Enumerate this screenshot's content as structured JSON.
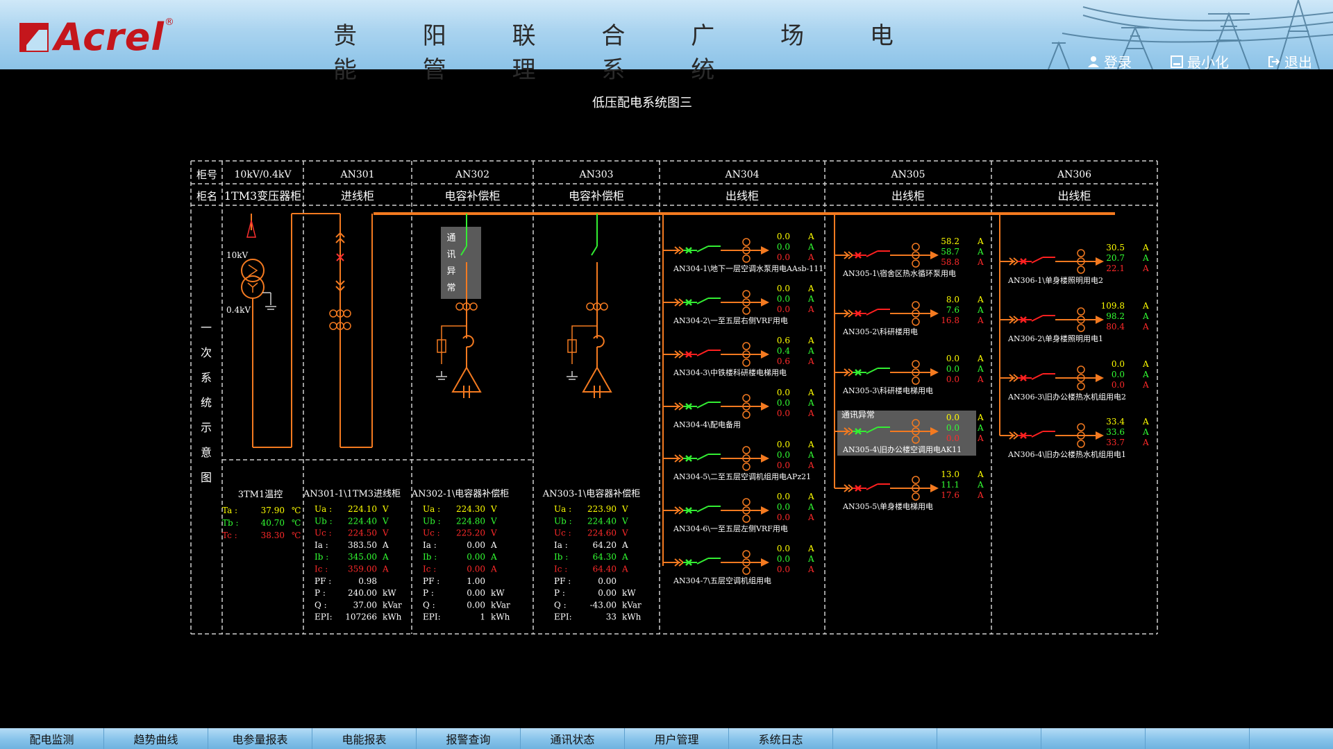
{
  "header": {
    "logo_text": "Acrel",
    "logo_reg": "®",
    "title": "贵 阳 联 合 广 场 电 能 管 理 系 统",
    "login_label": "登录",
    "minimize_label": "最小化",
    "exit_label": "退出"
  },
  "diagram": {
    "title": "低压配电系统图三",
    "row_labels": {
      "cabinet_no": "柜号",
      "cabinet_name": "柜名"
    },
    "side_label": "一次系统示意图",
    "columns": [
      {
        "no": "10kV/0.4kV",
        "name": "1TM3变压器柜"
      },
      {
        "no": "AN301",
        "name": "进线柜"
      },
      {
        "no": "AN302",
        "name": "电容补偿柜"
      },
      {
        "no": "AN303",
        "name": "电容补偿柜"
      },
      {
        "no": "AN304",
        "name": "出线柜"
      },
      {
        "no": "AN305",
        "name": "出线柜"
      },
      {
        "no": "AN306",
        "name": "出线柜"
      }
    ],
    "transformer_labels": {
      "hv": "10kV",
      "lv": "0.4kV"
    },
    "comm_error_vertical": "通讯异常",
    "comm_error": "通讯异常",
    "unit_a": "A",
    "temp_block": {
      "title": "3TM1温控",
      "rows": [
        {
          "label": "Ta :",
          "value": "37.90",
          "unit": "℃"
        },
        {
          "label": "Tb :",
          "value": "40.70",
          "unit": "℃"
        },
        {
          "label": "Tc :",
          "value": "38.30",
          "unit": "℃"
        }
      ]
    },
    "meter_blocks": [
      {
        "title": "AN301-1\\1TM3进线柜",
        "rows": [
          {
            "label": "Ua :",
            "value": "224.10",
            "unit": "V"
          },
          {
            "label": "Ub :",
            "value": "224.40",
            "unit": "V"
          },
          {
            "label": "Uc :",
            "value": "224.50",
            "unit": "V"
          },
          {
            "label": "Ia :",
            "value": "383.50",
            "unit": "A"
          },
          {
            "label": "Ib :",
            "value": "345.00",
            "unit": "A"
          },
          {
            "label": "Ic :",
            "value": "359.00",
            "unit": "A"
          },
          {
            "label": "PF :",
            "value": "0.98",
            "unit": ""
          },
          {
            "label": "P :",
            "value": "240.00",
            "unit": "kW"
          },
          {
            "label": "Q :",
            "value": "37.00",
            "unit": "kVar"
          },
          {
            "label": "EPI:",
            "value": "107266",
            "unit": "kWh"
          }
        ]
      },
      {
        "title": "AN302-1\\电容器补偿柜",
        "rows": [
          {
            "label": "Ua :",
            "value": "224.30",
            "unit": "V"
          },
          {
            "label": "Ub :",
            "value": "224.80",
            "unit": "V"
          },
          {
            "label": "Uc :",
            "value": "225.20",
            "unit": "V"
          },
          {
            "label": "Ia :",
            "value": "0.00",
            "unit": "A"
          },
          {
            "label": "Ib :",
            "value": "0.00",
            "unit": "A"
          },
          {
            "label": "Ic :",
            "value": "0.00",
            "unit": "A"
          },
          {
            "label": "PF :",
            "value": "1.00",
            "unit": ""
          },
          {
            "label": "P :",
            "value": "0.00",
            "unit": "kW"
          },
          {
            "label": "Q :",
            "value": "0.00",
            "unit": "kVar"
          },
          {
            "label": "EPI:",
            "value": "1",
            "unit": "kWh"
          }
        ]
      },
      {
        "title": "AN303-1\\电容器补偿柜",
        "rows": [
          {
            "label": "Ua :",
            "value": "223.90",
            "unit": "V"
          },
          {
            "label": "Ub :",
            "value": "224.40",
            "unit": "V"
          },
          {
            "label": "Uc :",
            "value": "224.60",
            "unit": "V"
          },
          {
            "label": "Ia :",
            "value": "64.20",
            "unit": "A"
          },
          {
            "label": "Ib :",
            "value": "64.30",
            "unit": "A"
          },
          {
            "label": "Ic :",
            "value": "64.40",
            "unit": "A"
          },
          {
            "label": "PF :",
            "value": "0.00",
            "unit": ""
          },
          {
            "label": "P :",
            "value": "0.00",
            "unit": "kW"
          },
          {
            "label": "Q :",
            "value": "-43.00",
            "unit": "kVar"
          },
          {
            "label": "EPI:",
            "value": "33",
            "unit": "kWh"
          }
        ]
      }
    ],
    "feeders": {
      "AN304": [
        {
          "name": "AN304-1\\地下一层空调水泵用电AAsb-111",
          "values": [
            "0.0",
            "0.0",
            "0.0"
          ],
          "closed": true
        },
        {
          "name": "AN304-2\\一至五层右侧VRF用电",
          "values": [
            "0.0",
            "0.0",
            "0.0"
          ],
          "closed": true
        },
        {
          "name": "AN304-3\\中铁楼科研楼电梯用电",
          "values": [
            "0.6",
            "0.4",
            "0.6"
          ],
          "closed": false
        },
        {
          "name": "AN304-4\\配电备用",
          "values": [
            "0.0",
            "0.0",
            "0.0"
          ],
          "closed": true
        },
        {
          "name": "AN304-5\\二至五层空调机组用电APz21",
          "values": [
            "0.0",
            "0.0",
            "0.0"
          ],
          "closed": true
        },
        {
          "name": "AN304-6\\一至五层左侧VRF用电",
          "values": [
            "0.0",
            "0.0",
            "0.0"
          ],
          "closed": true
        },
        {
          "name": "AN304-7\\五层空调机组用电",
          "values": [
            "0.0",
            "0.0",
            "0.0"
          ],
          "closed": true
        }
      ],
      "AN305": [
        {
          "name": "AN305-1\\宿舍区热水循环泵用电",
          "values": [
            "58.2",
            "58.7",
            "58.8"
          ],
          "closed": false,
          "comm_error": false
        },
        {
          "name": "AN305-2\\科研楼用电",
          "values": [
            "8.0",
            "7.6",
            "16.8"
          ],
          "closed": false,
          "comm_error": false
        },
        {
          "name": "AN305-3\\科研楼电梯用电",
          "values": [
            "0.0",
            "0.0",
            "0.0"
          ],
          "closed": true,
          "comm_error": false
        },
        {
          "name": "AN305-4\\旧办公楼空调用电AK11",
          "values": [
            "0.0",
            "0.0",
            "0.0"
          ],
          "closed": true,
          "comm_error": true
        },
        {
          "name": "AN305-5\\单身楼电梯用电",
          "values": [
            "13.0",
            "11.1",
            "17.6"
          ],
          "closed": false,
          "comm_error": false
        }
      ],
      "AN306": [
        {
          "name": "AN306-1\\单身楼照明用电2",
          "values": [
            "30.5",
            "20.7",
            "22.1"
          ],
          "closed": false
        },
        {
          "name": "AN306-2\\单身楼照明用电1",
          "values": [
            "109.8",
            "98.2",
            "80.4"
          ],
          "closed": false
        },
        {
          "name": "AN306-3\\旧办公楼热水机组用电2",
          "values": [
            "0.0",
            "0.0",
            "0.0"
          ],
          "closed": false
        },
        {
          "name": "AN306-4\\旧办公楼热水机组用电1",
          "values": [
            "33.4",
            "33.6",
            "33.7"
          ],
          "closed": false
        }
      ]
    }
  },
  "nav": {
    "items": [
      "配电监测",
      "趋势曲线",
      "电参量报表",
      "电能报表",
      "报警查询",
      "通讯状态",
      "用户管理",
      "系统日志"
    ]
  },
  "colors": {
    "bus": "#f47a20",
    "phase_a": "#ffff00",
    "phase_b": "#33ff33",
    "phase_c": "#ff2a2a",
    "grid": "#cfcfcf",
    "switch_closed": "#33ee33",
    "switch_open": "#ff2020",
    "comm_error_bg": "#5a5a5a"
  }
}
